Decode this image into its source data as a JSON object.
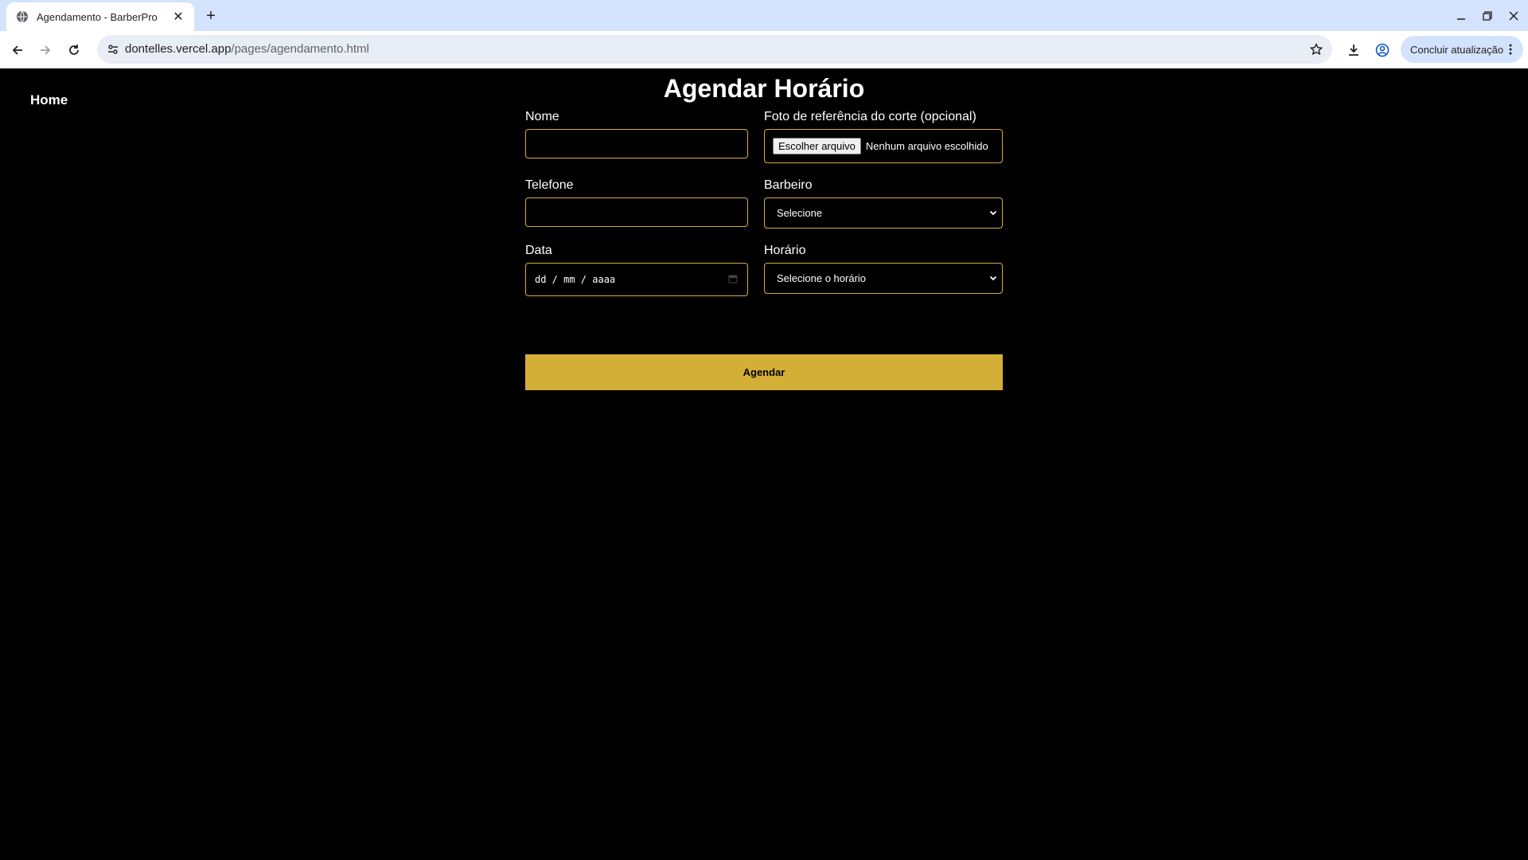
{
  "browser": {
    "tab_title": "Agendamento - BarberPro",
    "url_domain": "dontelles.vercel.app",
    "url_path": "/pages/agendamento.html",
    "update_button_label": "Concluir atualização"
  },
  "nav": {
    "home_label": "Home"
  },
  "page": {
    "title": "Agendar Horário"
  },
  "form": {
    "nome_label": "Nome",
    "nome_value": "",
    "foto_label": "Foto de referência do corte (opcional)",
    "file_button_label": "Escolher arquivo",
    "file_status": "Nenhum arquivo escolhido",
    "telefone_label": "Telefone",
    "telefone_value": "",
    "barbeiro_label": "Barbeiro",
    "barbeiro_selected": "Selecione",
    "data_label": "Data",
    "data_placeholder": "dd / mm / aaaa",
    "horario_label": "Horário",
    "horario_selected": "Selecione o horário",
    "submit_label": "Agendar"
  },
  "colors": {
    "accent": "#d4af37",
    "background": "#000000",
    "text": "#ffffff"
  }
}
